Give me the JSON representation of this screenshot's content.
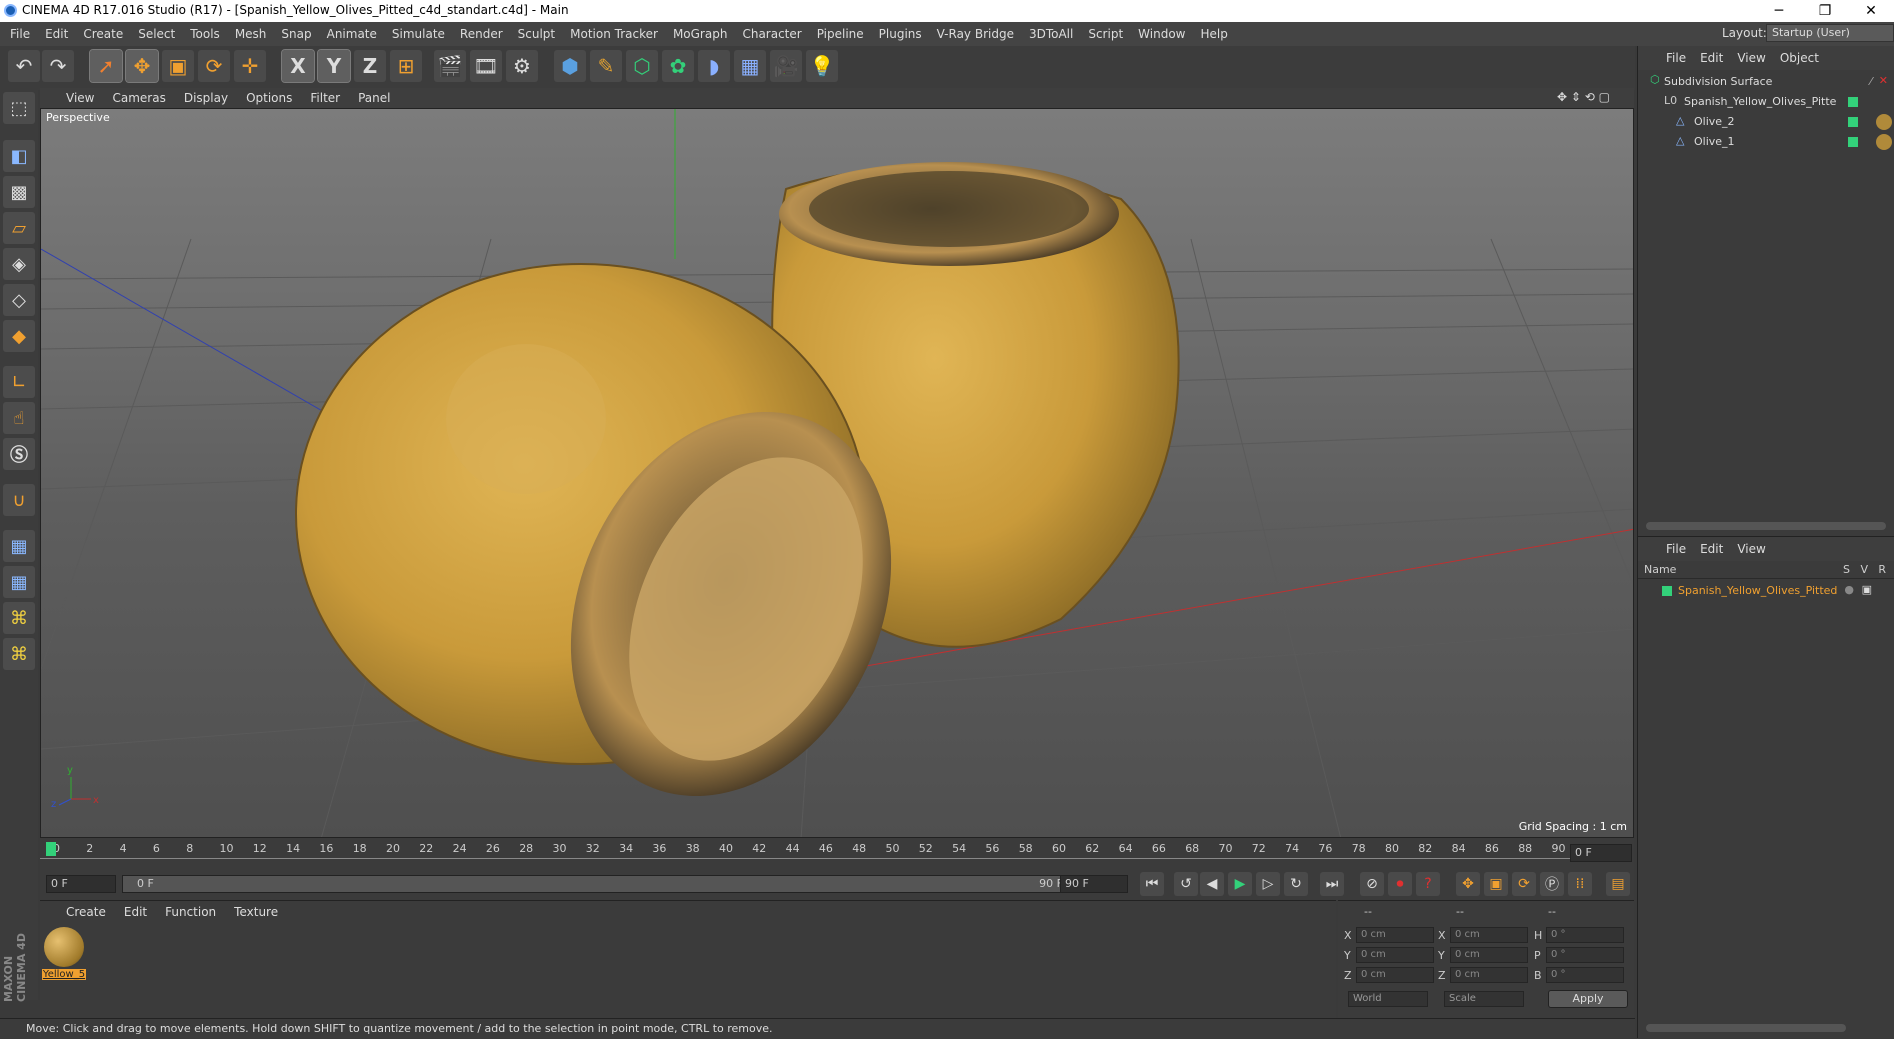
{
  "window": {
    "title": "CINEMA 4D R17.016 Studio (R17) - [Spanish_Yellow_Olives_Pitted_c4d_standart.c4d] - Main",
    "minimize": "─",
    "restore": "❐",
    "close": "✕"
  },
  "menu": [
    "File",
    "Edit",
    "Create",
    "Select",
    "Tools",
    "Mesh",
    "Snap",
    "Animate",
    "Simulate",
    "Render",
    "Sculpt",
    "Motion Tracker",
    "MoGraph",
    "Character",
    "Pipeline",
    "Plugins",
    "V-Ray Bridge",
    "3DToAll",
    "Script",
    "Window",
    "Help"
  ],
  "layout": {
    "label": "Layout:",
    "value": "Startup (User)"
  },
  "toolbar": {
    "axis_x": "X",
    "axis_y": "Y",
    "axis_z": "Z"
  },
  "viewport": {
    "menu": [
      "View",
      "Cameras",
      "Display",
      "Options",
      "Filter",
      "Panel"
    ],
    "name": "Perspective",
    "grid_spacing": "Grid Spacing : 1 cm"
  },
  "timeline": {
    "ticks": [
      "0",
      "2",
      "4",
      "6",
      "8",
      "10",
      "12",
      "14",
      "16",
      "18",
      "20",
      "22",
      "24",
      "26",
      "28",
      "30",
      "32",
      "34",
      "36",
      "38",
      "40",
      "42",
      "44",
      "46",
      "48",
      "50",
      "52",
      "54",
      "56",
      "58",
      "60",
      "62",
      "64",
      "66",
      "68",
      "70",
      "72",
      "74",
      "76",
      "78",
      "80",
      "82",
      "84",
      "86",
      "88",
      "90"
    ],
    "current_frame": "0 F",
    "start_frame": "0 F",
    "range_start": "0 F",
    "range_end": "90 F",
    "end_frame": "90 F"
  },
  "materials": {
    "menu": [
      "Create",
      "Edit",
      "Function",
      "Texture"
    ],
    "items": [
      {
        "label": "Yellow_5"
      }
    ]
  },
  "coordinates": {
    "header": [
      "--",
      "--",
      "--"
    ],
    "rows": [
      {
        "a": "X",
        "av": "0 cm",
        "b": "X",
        "bv": "0 cm",
        "c": "H",
        "cv": "0 °"
      },
      {
        "a": "Y",
        "av": "0 cm",
        "b": "Y",
        "bv": "0 cm",
        "c": "P",
        "cv": "0 °"
      },
      {
        "a": "Z",
        "av": "0 cm",
        "b": "Z",
        "bv": "0 cm",
        "c": "B",
        "cv": "0 °"
      }
    ],
    "space": "World",
    "mode": "Scale",
    "apply": "Apply"
  },
  "status": "Move: Click and drag to move elements. Hold down SHIFT to quantize movement / add to the selection in point mode, CTRL to remove.",
  "objects": {
    "menu": [
      "File",
      "Edit",
      "View",
      "Object"
    ],
    "tree": [
      {
        "label": "Subdivision Surface",
        "level": 0
      },
      {
        "label": "Spanish_Yellow_Olives_Pitte",
        "level": 1
      },
      {
        "label": "Olive_2",
        "level": 2
      },
      {
        "label": "Olive_1",
        "level": 2
      }
    ]
  },
  "attributes": {
    "menu": [
      "File",
      "Edit",
      "View"
    ],
    "columns": {
      "name": "Name",
      "s": "S",
      "v": "V",
      "r": "R"
    },
    "row": "Spanish_Yellow_Olives_Pitted"
  },
  "colors": {
    "accent": "#f0a030",
    "green": "#33d17a",
    "olive": "#c79a3a"
  }
}
